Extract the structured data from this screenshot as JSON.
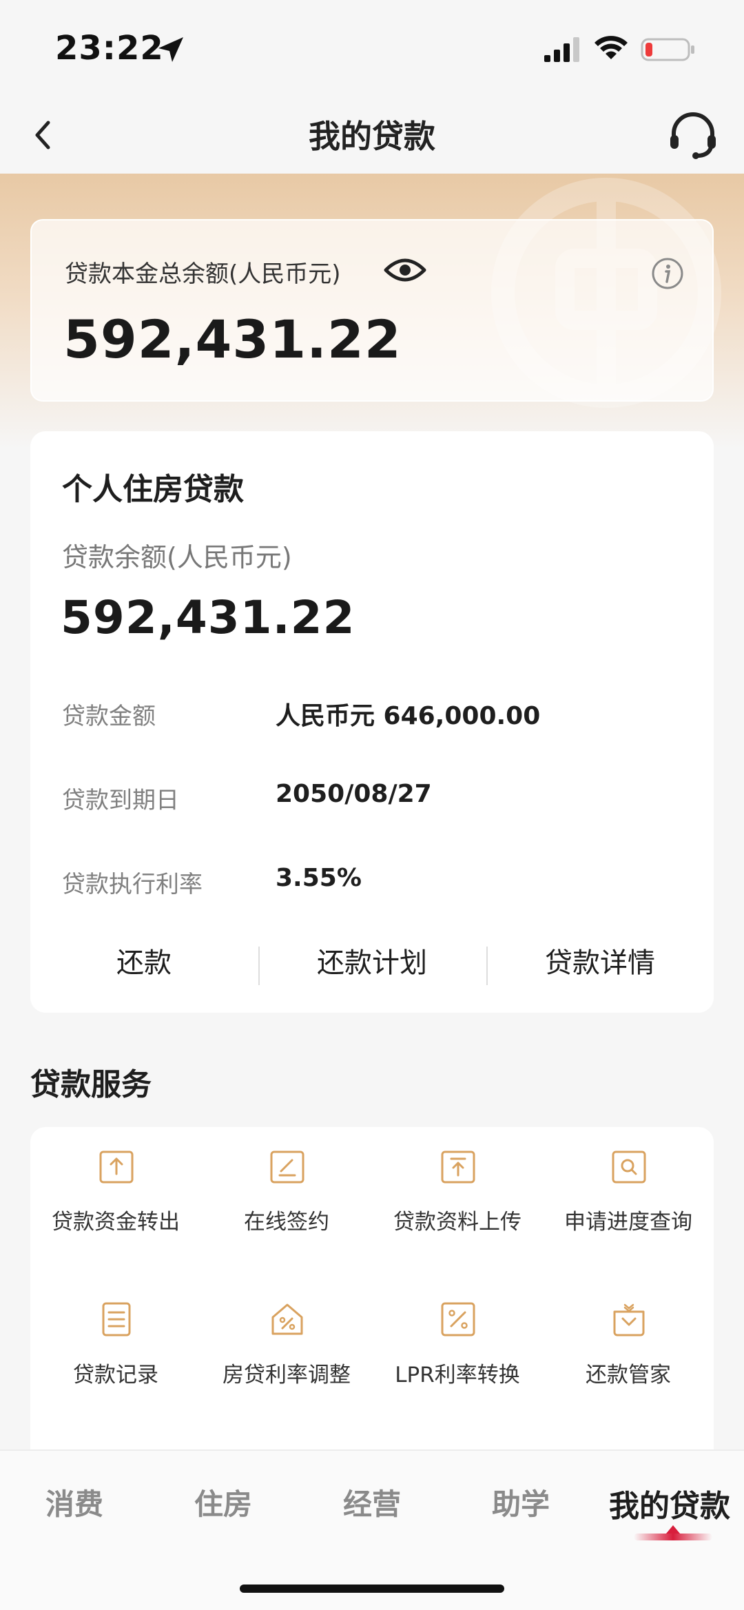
{
  "status_bar": {
    "time": "23:22"
  },
  "nav": {
    "title": "我的贷款"
  },
  "summary": {
    "label": "贷款本金总余额(人民币元)",
    "value": "592,431.22"
  },
  "loan": {
    "type": "个人住房贷款",
    "balance_label": "贷款余额(人民币元)",
    "balance_value": "592,431.22",
    "details": [
      {
        "label": "贷款金额",
        "value": "人民币元 646,000.00"
      },
      {
        "label": "贷款到期日",
        "value": "2050/08/27"
      },
      {
        "label": "贷款执行利率",
        "value": "3.55%"
      }
    ],
    "actions": [
      "还款",
      "还款计划",
      "贷款详情"
    ]
  },
  "services": {
    "title": "贷款服务",
    "items": [
      {
        "label": "贷款资金转出",
        "icon": "transfer-out-icon"
      },
      {
        "label": "在线签约",
        "icon": "sign-icon"
      },
      {
        "label": "贷款资料上传",
        "icon": "upload-icon"
      },
      {
        "label": "申请进度查询",
        "icon": "progress-search-icon"
      },
      {
        "label": "贷款记录",
        "icon": "record-icon"
      },
      {
        "label": "房贷利率调整",
        "icon": "house-rate-icon"
      },
      {
        "label": "LPR利率转换",
        "icon": "lpr-rate-icon"
      },
      {
        "label": "还款管家",
        "icon": "repay-butler-icon"
      }
    ]
  },
  "tabs": [
    "消费",
    "住房",
    "经营",
    "助学",
    "我的贷款"
  ],
  "active_tab": "我的贷款",
  "colors": {
    "accent": "#d81e3c",
    "icon_gold": "#d9a25f",
    "hero_top": "#e8c9a5"
  }
}
